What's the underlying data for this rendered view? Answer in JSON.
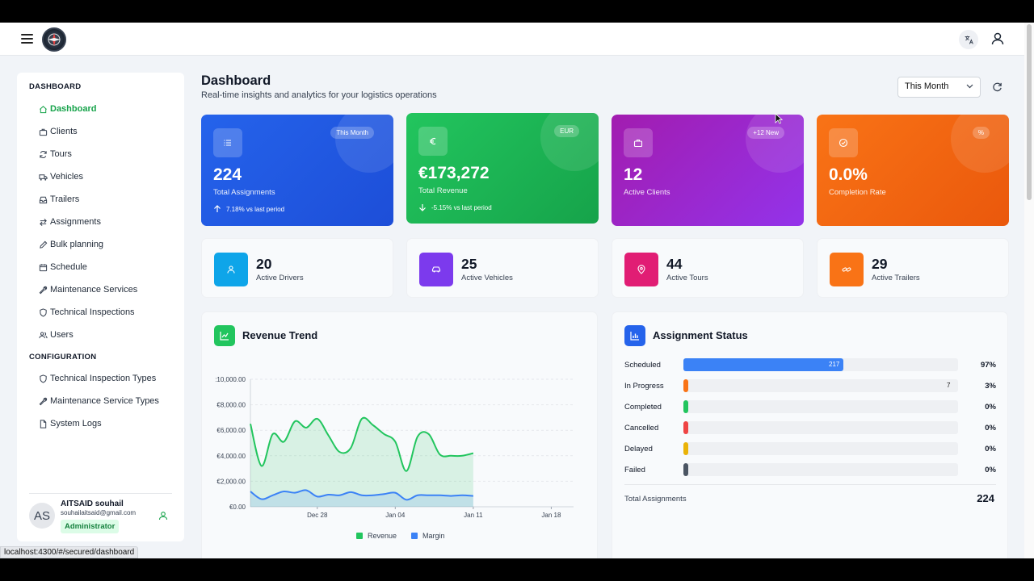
{
  "header": {
    "lang_icon": "translate-icon",
    "user_icon": "user-icon"
  },
  "sidebar": {
    "sections": [
      {
        "label": "DASHBOARD",
        "items": [
          {
            "label": "Dashboard",
            "icon": "home-icon",
            "active": true
          },
          {
            "label": "Clients",
            "icon": "briefcase-icon"
          },
          {
            "label": "Tours",
            "icon": "refresh-icon"
          },
          {
            "label": "Vehicles",
            "icon": "truck-icon"
          },
          {
            "label": "Trailers",
            "icon": "inbox-icon"
          },
          {
            "label": "Assignments",
            "icon": "swap-icon"
          },
          {
            "label": "Bulk planning",
            "icon": "pencil-icon"
          },
          {
            "label": "Schedule",
            "icon": "calendar-icon"
          },
          {
            "label": "Maintenance Services",
            "icon": "wrench-icon"
          },
          {
            "label": "Technical Inspections",
            "icon": "shield-icon"
          },
          {
            "label": "Users",
            "icon": "users-icon"
          }
        ]
      },
      {
        "label": "CONFIGURATION",
        "items": [
          {
            "label": "Technical Inspection Types",
            "icon": "shield-icon"
          },
          {
            "label": "Maintenance Service Types",
            "icon": "wrench-icon"
          },
          {
            "label": "System Logs",
            "icon": "file-icon"
          }
        ]
      }
    ],
    "user": {
      "initials": "AS",
      "name": "AITSAID souhail",
      "email": "souhailaitsaid@gmail.com",
      "role": "Administrator"
    }
  },
  "statusbar": {
    "url": "localhost:4300/#/secured/dashboard"
  },
  "page": {
    "title": "Dashboard",
    "subtitle": "Real-time insights and analytics for your logistics operations",
    "period": "This Month"
  },
  "kpi_cards": [
    {
      "value": "224",
      "label": "Total Assignments",
      "badge": "This Month",
      "trend": "7.18% vs last period",
      "trend_dir": "up",
      "color_from": "#2563eb",
      "color_to": "#1d4ed8",
      "icon": "list-icon"
    },
    {
      "value": "€173,272",
      "label": "Total Revenue",
      "badge": "EUR",
      "trend": "-5.15% vs last period",
      "trend_dir": "down",
      "color_from": "#22c55e",
      "color_to": "#16a34a",
      "icon": "euro-icon"
    },
    {
      "value": "12",
      "label": "Active Clients",
      "badge": "+12 New",
      "trend": "",
      "color_from": "#a21caf",
      "color_to": "#9333ea",
      "icon": "briefcase-icon"
    },
    {
      "value": "0.0%",
      "label": "Completion Rate",
      "badge": "%",
      "trend": "",
      "color_from": "#f97316",
      "color_to": "#ea580c",
      "icon": "check-circle-icon"
    }
  ],
  "stat_cards": [
    {
      "value": "20",
      "label": "Active Drivers",
      "color": "#0ea5e9",
      "icon": "driver-icon"
    },
    {
      "value": "25",
      "label": "Active Vehicles",
      "color": "#7c3aed",
      "icon": "car-icon"
    },
    {
      "value": "44",
      "label": "Active Tours",
      "color": "#e11d74",
      "icon": "pin-icon"
    },
    {
      "value": "29",
      "label": "Active Trailers",
      "color": "#f97316",
      "icon": "link-icon"
    }
  ],
  "revenue_panel": {
    "title": "Revenue Trend"
  },
  "status_panel": {
    "title": "Assignment Status",
    "total_label": "Total Assignments",
    "total_value": "224",
    "rows": [
      {
        "name": "Scheduled",
        "count": "217",
        "count_value": 217,
        "pct": "97%",
        "pct_value": 97,
        "color": "#3b82f6"
      },
      {
        "name": "In Progress",
        "count": "7",
        "count_value": 7,
        "pct": "3%",
        "pct_value": 3,
        "color": "#f97316"
      },
      {
        "name": "Completed",
        "count": "",
        "count_value": 0,
        "pct": "0%",
        "pct_value": 0,
        "color": "#22c55e"
      },
      {
        "name": "Cancelled",
        "count": "",
        "count_value": 0,
        "pct": "0%",
        "pct_value": 0,
        "color": "#ef4444"
      },
      {
        "name": "Delayed",
        "count": "",
        "count_value": 0,
        "pct": "0%",
        "pct_value": 0,
        "color": "#eab308"
      },
      {
        "name": "Failed",
        "count": "",
        "count_value": 0,
        "pct": "0%",
        "pct_value": 0,
        "color": "#4b5563"
      }
    ]
  },
  "chart_data": {
    "type": "area",
    "title": "Revenue Trend",
    "xlabel": "",
    "ylabel": "",
    "y_tick_labels": [
      ":10,000.00",
      "€8,000.00",
      "€6,000.00",
      "€4,000.00",
      "€2,000.00",
      "€0.00"
    ],
    "y_ticks": [
      10000,
      8000,
      6000,
      4000,
      2000,
      0
    ],
    "ylim": [
      0,
      10000
    ],
    "x_tick_labels": [
      "Dec 28",
      "Jan 04",
      "Jan 11",
      "Jan 18"
    ],
    "x_ticks": [
      6,
      13,
      20,
      27
    ],
    "xlim": [
      0,
      29
    ],
    "legend": "bottom",
    "series": [
      {
        "name": "Revenue",
        "color": "#22c55e",
        "x": [
          0,
          1,
          2,
          3,
          4,
          5,
          6,
          7,
          8,
          9,
          10,
          11,
          12,
          13,
          14,
          15,
          16,
          17,
          18,
          19,
          20
        ],
        "values": [
          6500,
          3200,
          5700,
          5100,
          6700,
          6200,
          6900,
          5600,
          4300,
          4600,
          6900,
          6400,
          5700,
          5100,
          2800,
          5500,
          5700,
          4100,
          4000,
          4000,
          4200
        ]
      },
      {
        "name": "Margin",
        "color": "#3b82f6",
        "x": [
          0,
          1,
          2,
          3,
          4,
          5,
          6,
          7,
          8,
          9,
          10,
          11,
          12,
          13,
          14,
          15,
          16,
          17,
          18,
          19,
          20
        ],
        "values": [
          1200,
          600,
          900,
          1200,
          1100,
          1300,
          800,
          950,
          900,
          1150,
          900,
          900,
          1000,
          1100,
          550,
          900,
          900,
          900,
          850,
          900,
          850
        ]
      }
    ]
  }
}
